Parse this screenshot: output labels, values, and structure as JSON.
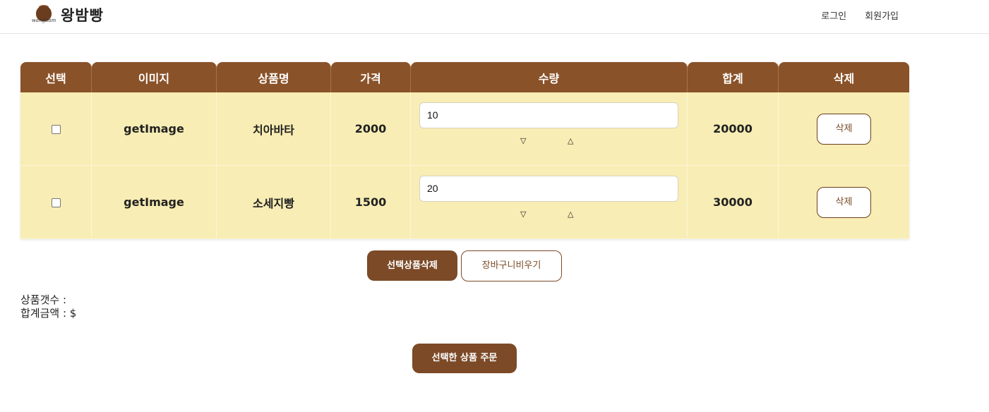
{
  "brand": {
    "name": "왕밤빵",
    "logo_script": "wangbam",
    "logo_icon": "chestnut-icon"
  },
  "nav": {
    "login": "로그인",
    "signup": "회원가입"
  },
  "table": {
    "headers": [
      "선택",
      "이미지",
      "상품명",
      "가격",
      "수량",
      "합계",
      "삭제"
    ],
    "rows": [
      {
        "image": "getImage",
        "name": "치아바타",
        "price": "2000",
        "qty": "10",
        "total": "20000",
        "delete": "삭제"
      },
      {
        "image": "getImage",
        "name": "소세지빵",
        "price": "1500",
        "qty": "20",
        "total": "30000",
        "delete": "삭제"
      }
    ],
    "qty_down_glyph": "▽",
    "qty_up_glyph": "△"
  },
  "actions": {
    "delete_selected": "선택상품삭제",
    "clear_cart": "장바구니비우기"
  },
  "summary": {
    "count_label": "상품갯수 :",
    "amount_label": "합계금액 : $"
  },
  "order": {
    "label": "선택한 상품 주문"
  },
  "colors": {
    "header_brown": "#8a5229",
    "button_brown": "#7c4a27",
    "row_cream": "#f8edb4"
  }
}
